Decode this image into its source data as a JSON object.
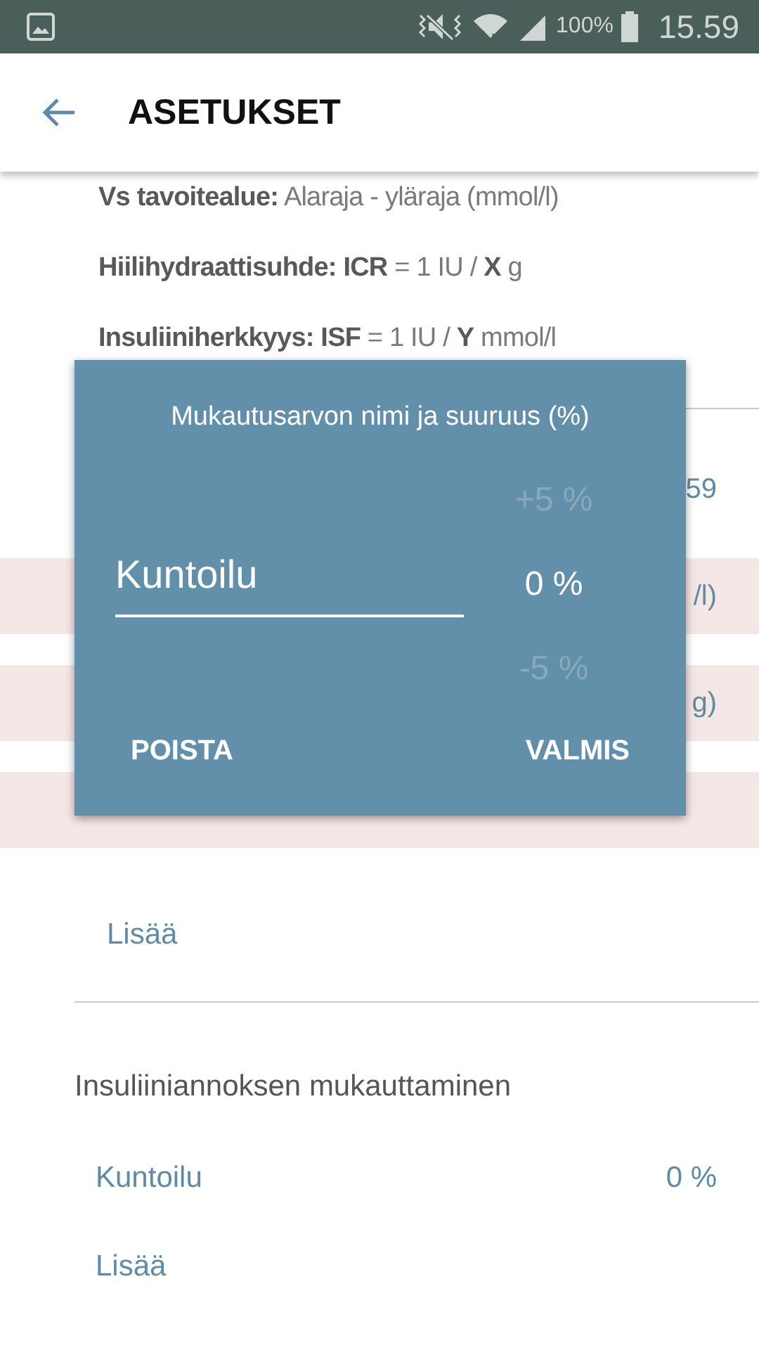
{
  "status_bar": {
    "battery": "100%",
    "time": "15.59"
  },
  "app_bar": {
    "title": "ASETUKSET"
  },
  "info_lines": [
    "**Vs tavoitealue:** Alaraja - yläraja (mmol/l)",
    "**Hiilihydraattisuhde: ICR** = 1 IU / **X** g",
    "**Insuliiniherkkyys: ISF** = 1 IU / **Y** mmol/l"
  ],
  "settings_rows": [
    {
      "value": "59",
      "highlighted": false
    },
    {
      "value": "/l)",
      "highlighted": true
    },
    {
      "value": "g)",
      "highlighted": true
    },
    {
      "highlighted": true
    }
  ],
  "add_link_1": "Lisää",
  "adjust_section": {
    "title": "Insuliiniannoksen mukauttaminen",
    "items": [
      {
        "name": "Kuntoilu",
        "value": "0 %"
      }
    ],
    "add_link": "Lisää"
  },
  "dialog": {
    "title": "Mukautusarvon nimi ja suuruus (%)",
    "name_value": "Kuntoilu",
    "picker": [
      {
        "label": "+5 %",
        "selected": false
      },
      {
        "label": "0 %",
        "selected": true
      },
      {
        "label": "-5 %",
        "selected": false
      }
    ],
    "buttons": [
      "POISTA",
      "VALMIS"
    ]
  }
}
